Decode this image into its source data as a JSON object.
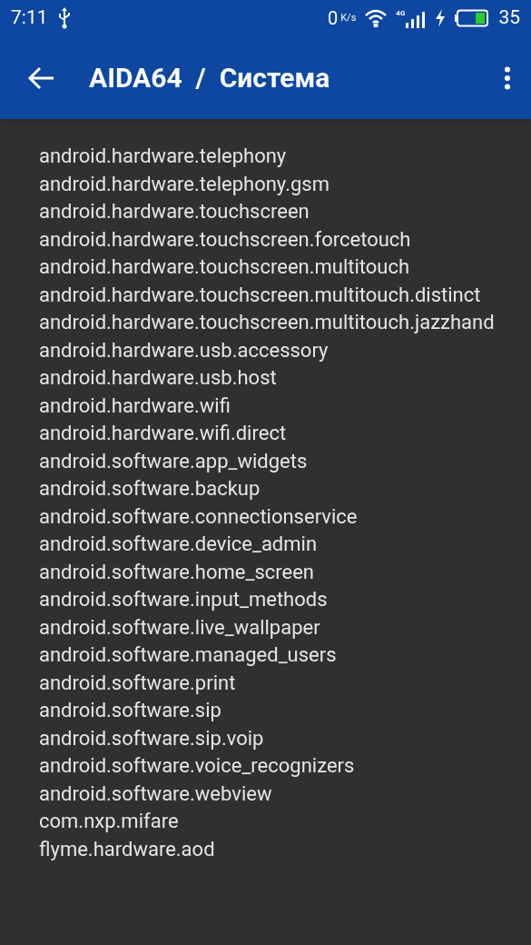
{
  "status_bar": {
    "time": "7:11",
    "speed_value": "0",
    "speed_unit": "K/s",
    "network": "4G",
    "battery": "35"
  },
  "app_bar": {
    "title": "AIDA64  /  Система"
  },
  "features": [
    "android.hardware.telephony",
    "android.hardware.telephony.gsm",
    "android.hardware.touchscreen",
    "android.hardware.touchscreen.forcetouch",
    "android.hardware.touchscreen.multitouch",
    "android.hardware.touchscreen.multitouch.distinct",
    "android.hardware.touchscreen.multitouch.jazzhand",
    "android.hardware.usb.accessory",
    "android.hardware.usb.host",
    "android.hardware.wifi",
    "android.hardware.wifi.direct",
    "android.software.app_widgets",
    "android.software.backup",
    "android.software.connectionservice",
    "android.software.device_admin",
    "android.software.home_screen",
    "android.software.input_methods",
    "android.software.live_wallpaper",
    "android.software.managed_users",
    "android.software.print",
    "android.software.sip",
    "android.software.sip.voip",
    "android.software.voice_recognizers",
    "android.software.webview",
    "com.nxp.mifare",
    "flyme.hardware.aod"
  ]
}
